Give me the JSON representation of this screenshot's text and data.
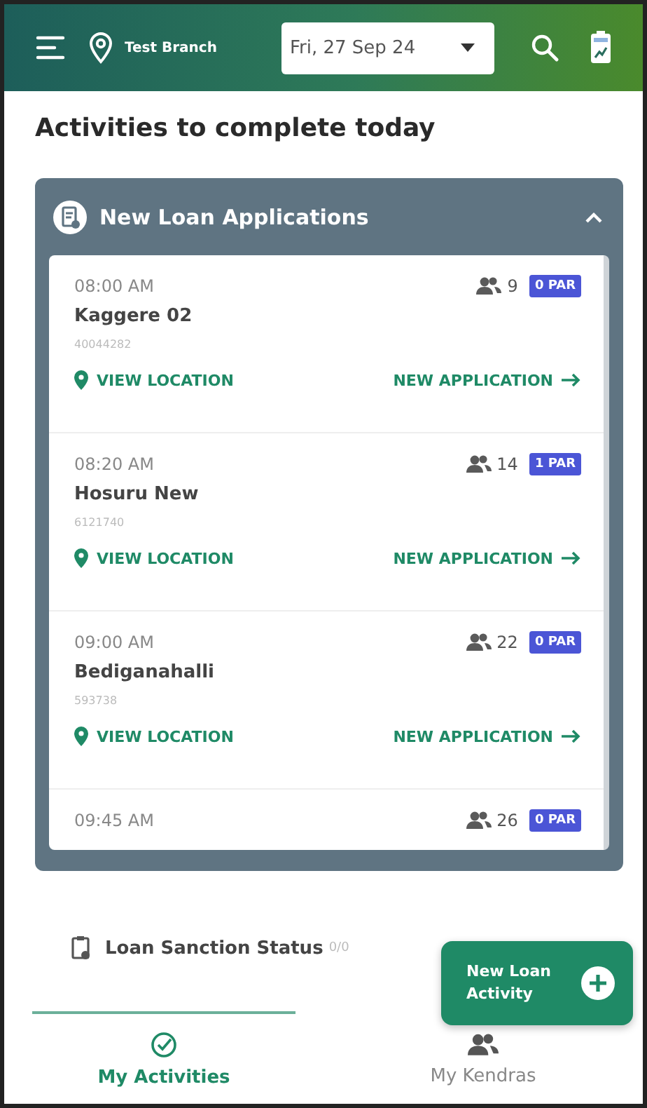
{
  "header": {
    "branch": "Test Branch",
    "date": "Fri, 27 Sep 24"
  },
  "title": "Activities to complete today",
  "section": {
    "title": "New Loan Applications",
    "expanded": true,
    "items": [
      {
        "time": "08:00 AM",
        "name": "Kaggere 02",
        "code": "40044282",
        "members": "9",
        "par": "0 PAR",
        "location_action": "VIEW LOCATION",
        "primary_action": "NEW APPLICATION"
      },
      {
        "time": "08:20 AM",
        "name": "Hosuru New",
        "code": "6121740",
        "members": "14",
        "par": "1 PAR",
        "location_action": "VIEW LOCATION",
        "primary_action": "NEW APPLICATION"
      },
      {
        "time": "09:00 AM",
        "name": "Bediganahalli",
        "code": "593738",
        "members": "22",
        "par": "0 PAR",
        "location_action": "VIEW LOCATION",
        "primary_action": "NEW APPLICATION"
      },
      {
        "time": "09:45 AM",
        "members": "26",
        "par": "0 PAR"
      }
    ]
  },
  "sanction": {
    "label": "Loan Sanction Status",
    "count": "0/0"
  },
  "fab": {
    "label": "New Loan Activity"
  },
  "tabs": [
    {
      "label": "My Activities",
      "kind": "activities",
      "selected": true
    },
    {
      "label": "My Kendras",
      "kind": "kendras",
      "selected": false
    }
  ]
}
